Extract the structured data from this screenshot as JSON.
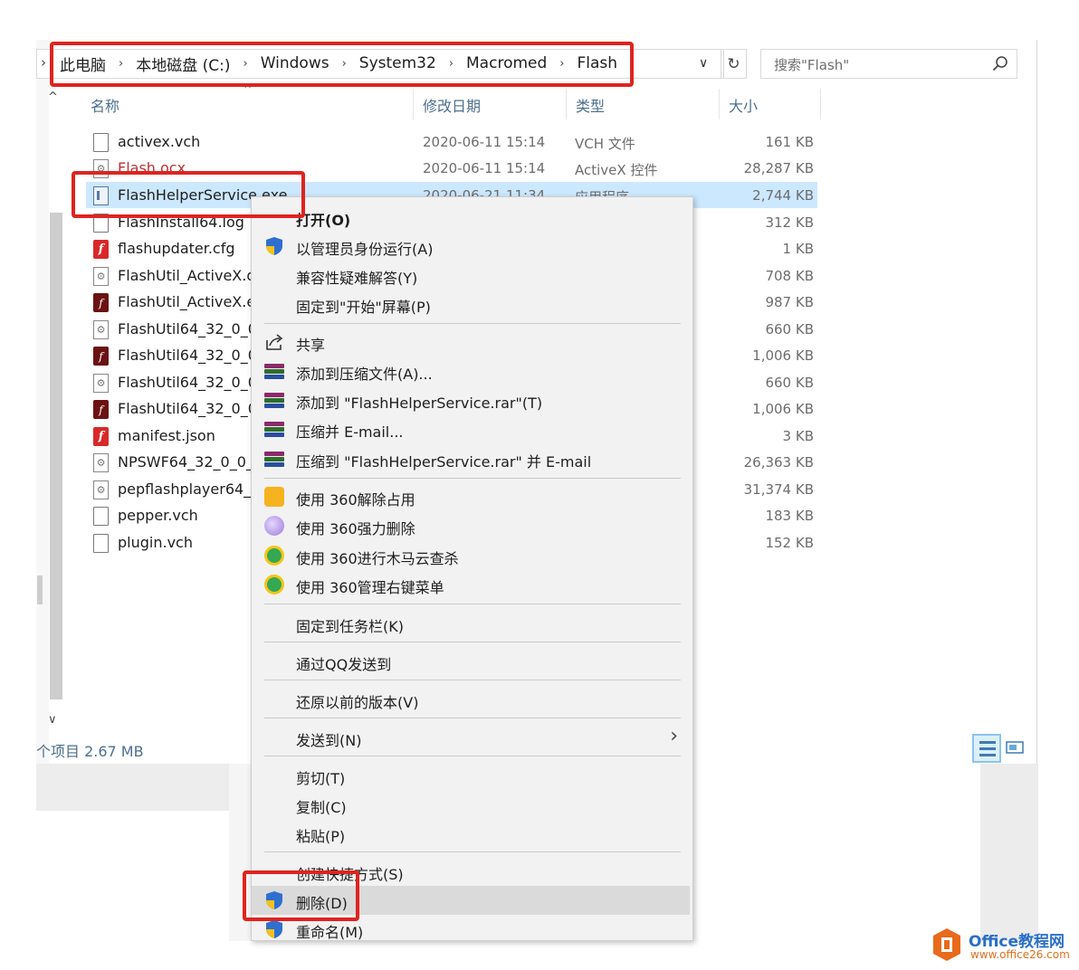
{
  "breadcrumb": [
    "此电脑",
    "本地磁盘 (C:)",
    "Windows",
    "System32",
    "Macromed",
    "Flash"
  ],
  "search": {
    "placeholder": "搜索\"Flash\""
  },
  "columns": {
    "name": "名称",
    "date": "修改日期",
    "type": "类型",
    "size": "大小"
  },
  "files": [
    {
      "name": "activex.vch",
      "date": "2020-06-11 15:14",
      "type": "VCH 文件",
      "size": "161 KB",
      "icon": "doc-icon"
    },
    {
      "name": "Flash.ocx",
      "date": "2020-06-11 15:14",
      "type": "ActiveX 控件",
      "size": "28,287 KB",
      "icon": "gear-file-icon"
    },
    {
      "name": "FlashHelperService.exe",
      "date": "2020-06-21 11:34",
      "type": "应用程序",
      "size": "2,744 KB",
      "icon": "app-icon",
      "selected": true
    },
    {
      "name": "FlashInstall64.log",
      "date": "",
      "type": "",
      "size": "312 KB",
      "icon": "doc-icon"
    },
    {
      "name": "flashupdater.cfg",
      "date": "",
      "type": "",
      "size": "1 KB",
      "icon": "flash-red-icon"
    },
    {
      "name": "FlashUtil_ActiveX.d",
      "date": "",
      "type": "",
      "size": "708 KB",
      "icon": "gear-file-icon"
    },
    {
      "name": "FlashUtil_ActiveX.e",
      "date": "",
      "type": "",
      "size": "987 KB",
      "icon": "flash-dark-icon"
    },
    {
      "name": "FlashUtil64_32_0_0",
      "date": "",
      "type": "",
      "size": "660 KB",
      "icon": "gear-file-icon"
    },
    {
      "name": "FlashUtil64_32_0_0",
      "date": "",
      "type": "",
      "size": "1,006 KB",
      "icon": "flash-dark-icon"
    },
    {
      "name": "FlashUtil64_32_0_0",
      "date": "",
      "type": "",
      "size": "660 KB",
      "icon": "gear-file-icon"
    },
    {
      "name": "FlashUtil64_32_0_0",
      "date": "",
      "type": "",
      "size": "1,006 KB",
      "icon": "flash-dark-icon"
    },
    {
      "name": "manifest.json",
      "date": "",
      "type": "",
      "size": "3 KB",
      "icon": "flash-red-icon"
    },
    {
      "name": "NPSWF64_32_0_0_",
      "date": "",
      "type": "",
      "size": "26,363 KB",
      "icon": "gear-file-icon"
    },
    {
      "name": "pepflashplayer64_",
      "date": "",
      "type": "",
      "size": "31,374 KB",
      "icon": "gear-file-icon"
    },
    {
      "name": "pepper.vch",
      "date": "",
      "type": "",
      "size": "183 KB",
      "icon": "doc-icon"
    },
    {
      "name": "plugin.vch",
      "date": "",
      "type": "",
      "size": "152 KB",
      "icon": "doc-icon"
    }
  ],
  "status": {
    "text": "个项目  2.67 MB"
  },
  "menu": {
    "open": "打开(O)",
    "run_as_admin": "以管理员身份运行(A)",
    "compat": "兼容性疑难解答(Y)",
    "pin_start": "固定到\"开始\"屏幕(P)",
    "share": "共享",
    "add_archive": "添加到压缩文件(A)...",
    "add_rar": "添加到 \"FlashHelperService.rar\"(T)",
    "compress_email": "压缩并 E-mail...",
    "compress_rar_email": "压缩到 \"FlashHelperService.rar\" 并 E-mail",
    "unlock_360": "使用 360解除占用",
    "force_delete_360": "使用 360强力删除",
    "trojan_scan_360": "使用 360进行木马云查杀",
    "manage_menu_360": "使用 360管理右键菜单",
    "pin_taskbar": "固定到任务栏(K)",
    "send_qq": "通过QQ发送到",
    "restore_prev": "还原以前的版本(V)",
    "send_to": "发送到(N)",
    "cut": "剪切(T)",
    "copy": "复制(C)",
    "paste": "粘贴(P)",
    "create_shortcut": "创建快捷方式(S)",
    "delete": "删除(D)",
    "rename": "重命名(M)"
  },
  "watermark": {
    "title": "Office教程网",
    "url": "www.office26.com"
  },
  "colors": {
    "highlight": "#e0231f",
    "selection": "#cce8ff",
    "header_text": "#4d6f8f"
  }
}
